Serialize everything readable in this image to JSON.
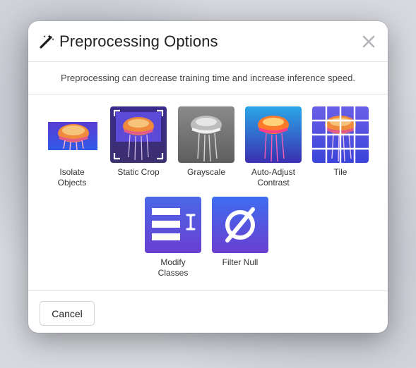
{
  "dialog": {
    "title": "Preprocessing Options",
    "description": "Preprocessing can decrease training time and increase inference speed."
  },
  "icons": {
    "title_icon": "magic-wand-icon",
    "close_icon": "close-icon"
  },
  "options": [
    {
      "label_line1": "Isolate",
      "label_line2": "Objects",
      "icon": "isolate-objects-thumbnail"
    },
    {
      "label_line1": "Static Crop",
      "label_line2": "",
      "icon": "static-crop-thumbnail"
    },
    {
      "label_line1": "Grayscale",
      "label_line2": "",
      "icon": "grayscale-thumbnail"
    },
    {
      "label_line1": "Auto-Adjust",
      "label_line2": "Contrast",
      "icon": "auto-contrast-thumbnail"
    },
    {
      "label_line1": "Tile",
      "label_line2": "",
      "icon": "tile-thumbnail"
    },
    {
      "label_line1": "Modify",
      "label_line2": "Classes",
      "icon": "modify-classes-icon"
    },
    {
      "label_line1": "Filter Null",
      "label_line2": "",
      "icon": "filter-null-icon"
    }
  ],
  "footer": {
    "cancel_label": "Cancel"
  },
  "colors": {
    "accent_purple": "#6b3fd6",
    "accent_blue": "#3a6df0",
    "jelly_orange": "#f08a3c",
    "jelly_pink": "#e25a8a"
  }
}
